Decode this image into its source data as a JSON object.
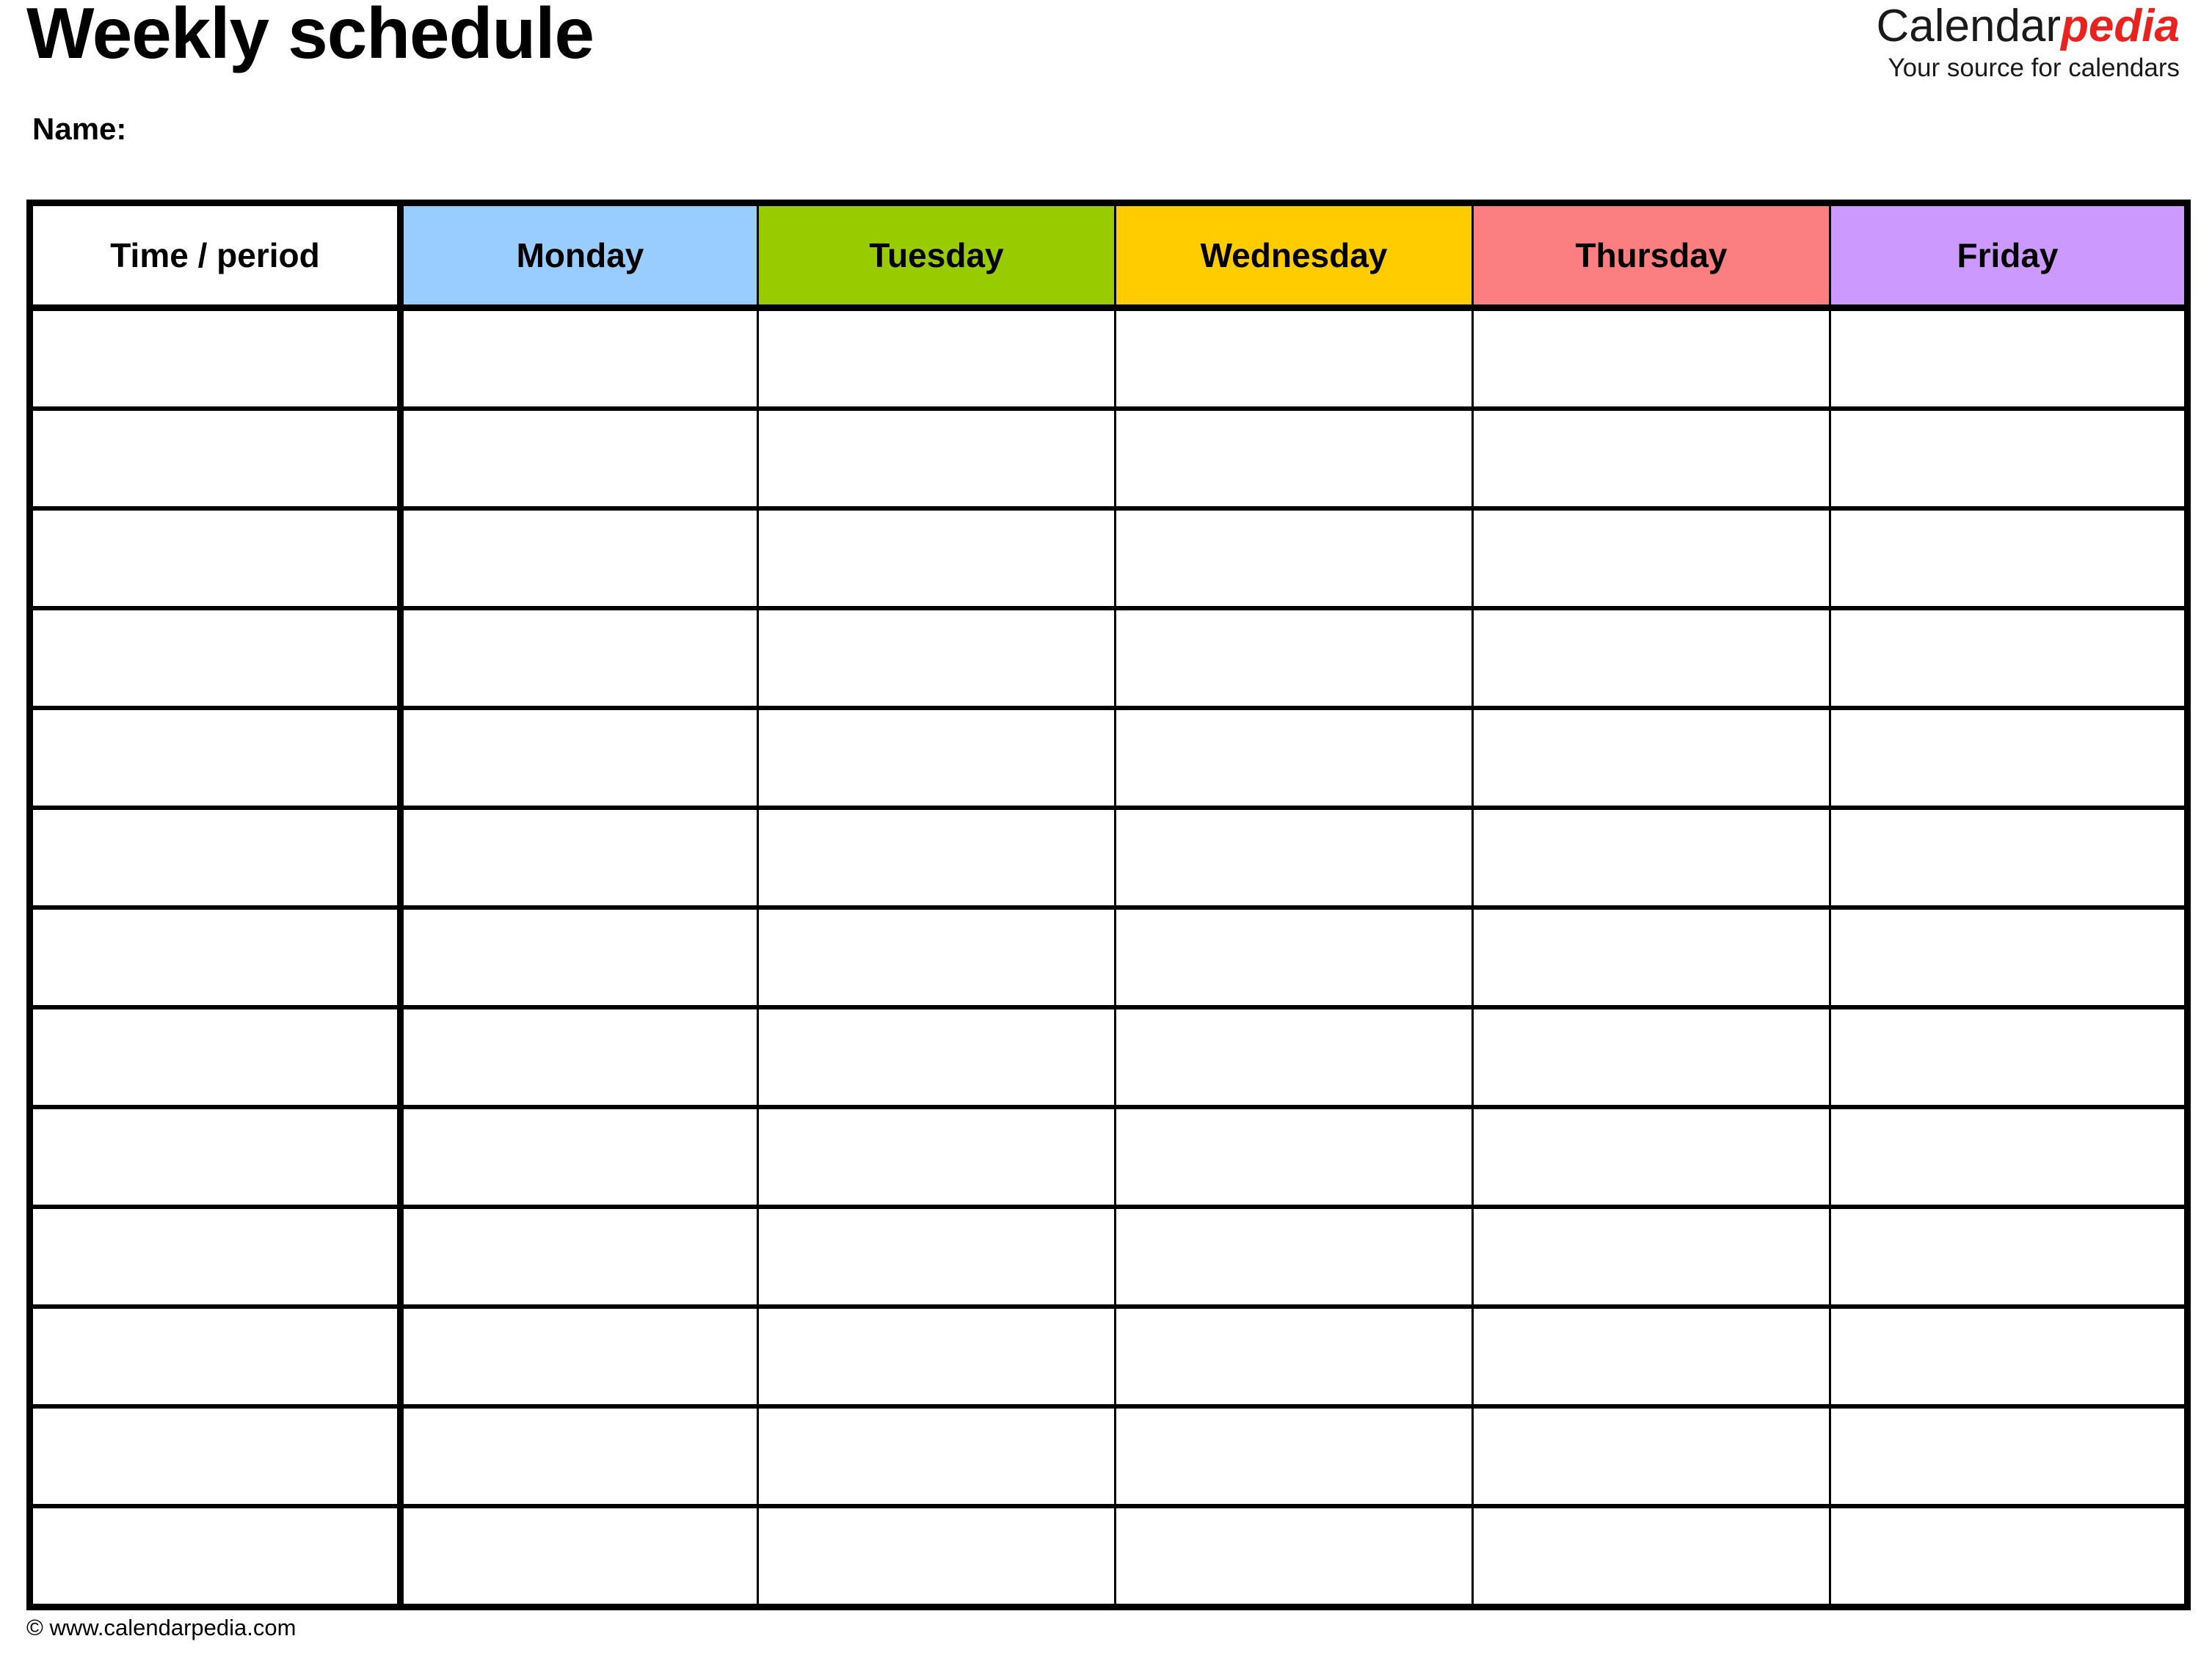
{
  "document": {
    "title": "Weekly schedule",
    "name_label": "Name:"
  },
  "brand": {
    "word_primary": "Calendar",
    "word_accent": "pedia",
    "tagline": "Your source for calendars",
    "accent_color": "#e8231f",
    "primary_color": "#1a1a1a"
  },
  "table": {
    "columns": [
      {
        "key": "time",
        "label": "Time / period",
        "header_color": "#ffffff"
      },
      {
        "key": "monday",
        "label": "Monday",
        "header_color": "#99ccff"
      },
      {
        "key": "tuesday",
        "label": "Tuesday",
        "header_color": "#99cc00"
      },
      {
        "key": "wednesday",
        "label": "Wednesday",
        "header_color": "#ffcc00"
      },
      {
        "key": "thursday",
        "label": "Thursday",
        "header_color": "#fb7e81"
      },
      {
        "key": "friday",
        "label": "Friday",
        "header_color": "#cc99ff"
      }
    ],
    "row_count": 13,
    "rows": [
      {
        "time": "",
        "monday": "",
        "tuesday": "",
        "wednesday": "",
        "thursday": "",
        "friday": ""
      },
      {
        "time": "",
        "monday": "",
        "tuesday": "",
        "wednesday": "",
        "thursday": "",
        "friday": ""
      },
      {
        "time": "",
        "monday": "",
        "tuesday": "",
        "wednesday": "",
        "thursday": "",
        "friday": ""
      },
      {
        "time": "",
        "monday": "",
        "tuesday": "",
        "wednesday": "",
        "thursday": "",
        "friday": ""
      },
      {
        "time": "",
        "monday": "",
        "tuesday": "",
        "wednesday": "",
        "thursday": "",
        "friday": ""
      },
      {
        "time": "",
        "monday": "",
        "tuesday": "",
        "wednesday": "",
        "thursday": "",
        "friday": ""
      },
      {
        "time": "",
        "monday": "",
        "tuesday": "",
        "wednesday": "",
        "thursday": "",
        "friday": ""
      },
      {
        "time": "",
        "monday": "",
        "tuesday": "",
        "wednesday": "",
        "thursday": "",
        "friday": ""
      },
      {
        "time": "",
        "monday": "",
        "tuesday": "",
        "wednesday": "",
        "thursday": "",
        "friday": ""
      },
      {
        "time": "",
        "monday": "",
        "tuesday": "",
        "wednesday": "",
        "thursday": "",
        "friday": ""
      },
      {
        "time": "",
        "monday": "",
        "tuesday": "",
        "wednesday": "",
        "thursday": "",
        "friday": ""
      },
      {
        "time": "",
        "monday": "",
        "tuesday": "",
        "wednesday": "",
        "thursday": "",
        "friday": ""
      },
      {
        "time": "",
        "monday": "",
        "tuesday": "",
        "wednesday": "",
        "thursday": "",
        "friday": ""
      }
    ]
  },
  "footer": {
    "copyright": "© www.calendarpedia.com"
  }
}
